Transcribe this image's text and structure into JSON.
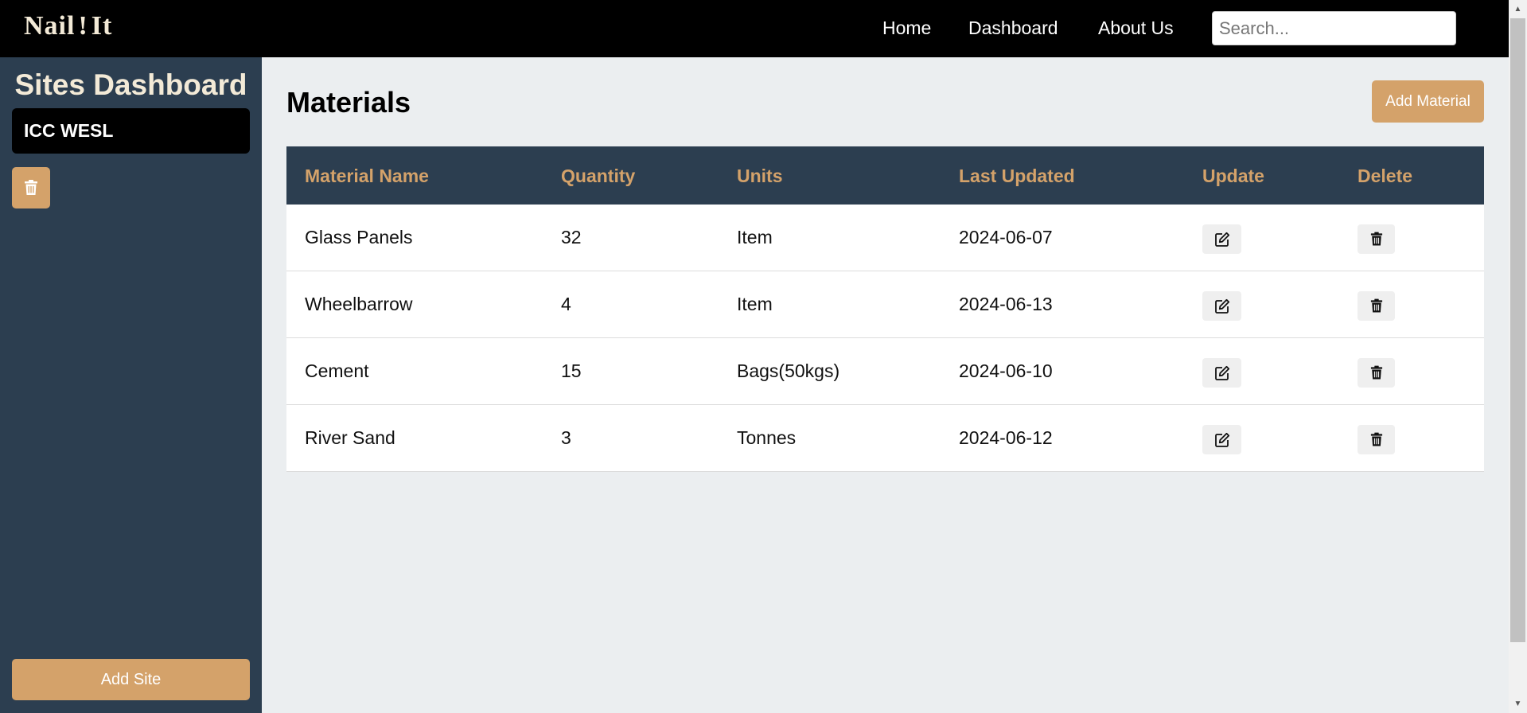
{
  "header": {
    "logo_left": "Nail",
    "logo_mark": "!",
    "logo_right": "It",
    "nav": [
      "Home",
      "Dashboard",
      "About Us"
    ],
    "search_placeholder": "Search..."
  },
  "sidebar": {
    "title": "Sites Dashboard",
    "sites": [
      "ICC WESL"
    ],
    "add_site_label": "Add Site"
  },
  "main": {
    "title": "Materials",
    "add_material_label": "Add Material",
    "columns": [
      "Material Name",
      "Quantity",
      "Units",
      "Last Updated",
      "Update",
      "Delete"
    ],
    "rows": [
      {
        "name": "Glass Panels",
        "quantity": "32",
        "units": "Item",
        "updated": "2024-06-07"
      },
      {
        "name": "Wheelbarrow",
        "quantity": "4",
        "units": "Item",
        "updated": "2024-06-13"
      },
      {
        "name": "Cement",
        "quantity": "15",
        "units": "Bags(50kgs)",
        "updated": "2024-06-10"
      },
      {
        "name": "River Sand",
        "quantity": "3",
        "units": "Tonnes",
        "updated": "2024-06-12"
      }
    ]
  },
  "icons": {
    "edit": "edit-icon",
    "delete": "trash-icon"
  },
  "colors": {
    "accent": "#d4a26a",
    "sidebar_bg": "#2c3e50",
    "topbar_bg": "#000000",
    "page_bg": "#ebeef0"
  }
}
